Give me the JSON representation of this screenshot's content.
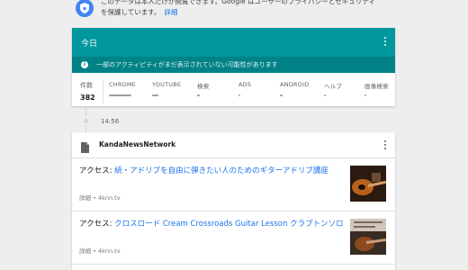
{
  "notice": {
    "line1": "このデータは本人だけが閲覧できます。Google はユーザーのプライバシーとセキュリティ",
    "line2": "を保護しています。",
    "link": "詳細",
    "icon": "shield-lock-icon",
    "accent": "#4285f4"
  },
  "today": {
    "title": "今日",
    "header_color": "#00979d",
    "info_color": "#008287",
    "info_text": "一部のアクティビティがまだ表示されていない可能性があります",
    "count_label": "件数",
    "count_value": "382",
    "categories": [
      {
        "label": "CHROME",
        "level": 0.9
      },
      {
        "label": "YOUTUBE",
        "level": 0.25
      },
      {
        "label": "検索",
        "level": 0.1
      },
      {
        "label": "ADS",
        "level": 0.05
      },
      {
        "label": "ANDROID",
        "level": 0.1
      },
      {
        "label": "ヘルプ",
        "level": 0.05
      },
      {
        "label": "画像検索",
        "level": 0.05
      }
    ]
  },
  "timeline": {
    "time": "14:56"
  },
  "news": {
    "source": "KandaNewsNetwork",
    "items": [
      {
        "prefix": "アクセス: ",
        "title": "続・アドリブを自由に弾きたい人のためのギターアドリブ講座",
        "meta": "詳細 • 4knn.tv"
      },
      {
        "prefix": "アクセス: ",
        "title": "クロスロード Cream Crossroads Guitar Lesson クラプトンソロ",
        "meta": "詳細 • 4knn.tv"
      }
    ]
  }
}
